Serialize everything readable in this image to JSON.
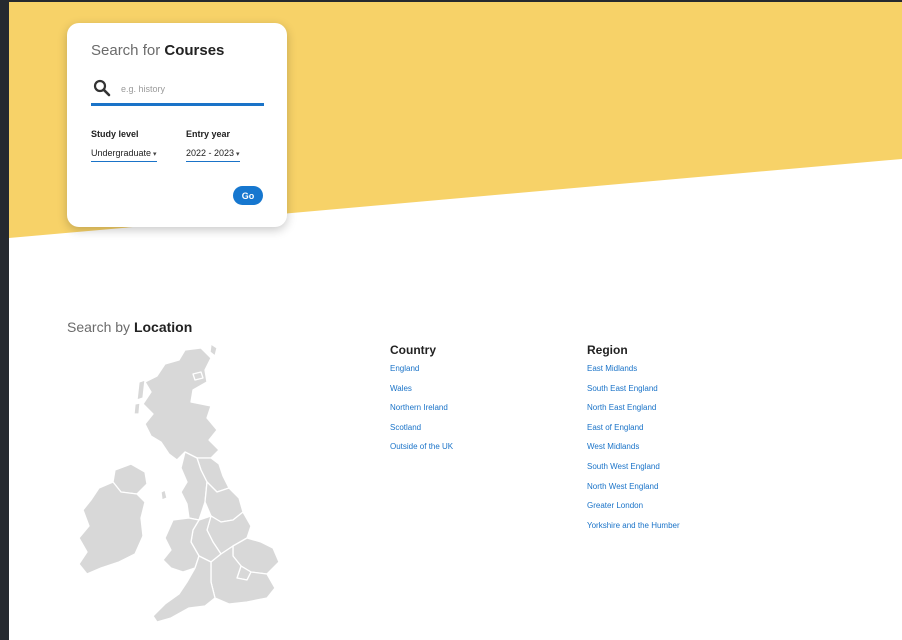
{
  "search_courses": {
    "title_prefix": "Search for",
    "title_strong": "Courses",
    "search_placeholder": "e.g. history",
    "study_level": {
      "label": "Study level",
      "value": "Undergraduate"
    },
    "entry_year": {
      "label": "Entry year",
      "value": "2022 - 2023"
    },
    "go_label": "Go"
  },
  "search_location": {
    "title_prefix": "Search by",
    "title_strong": "Location"
  },
  "country": {
    "heading": "Country",
    "items": [
      "England",
      "Wales",
      "Northern Ireland",
      "Scotland",
      "Outside of the UK"
    ]
  },
  "region": {
    "heading": "Region",
    "items": [
      "East Midlands",
      "South East England",
      "North East England",
      "East of England",
      "West Midlands",
      "South West England",
      "North West England",
      "Greater London",
      "Yorkshire and the Humber"
    ]
  },
  "colors": {
    "hero_yellow": "#f7d268",
    "accent_blue": "#1a73c8",
    "map_grey": "#d8d8d8"
  }
}
